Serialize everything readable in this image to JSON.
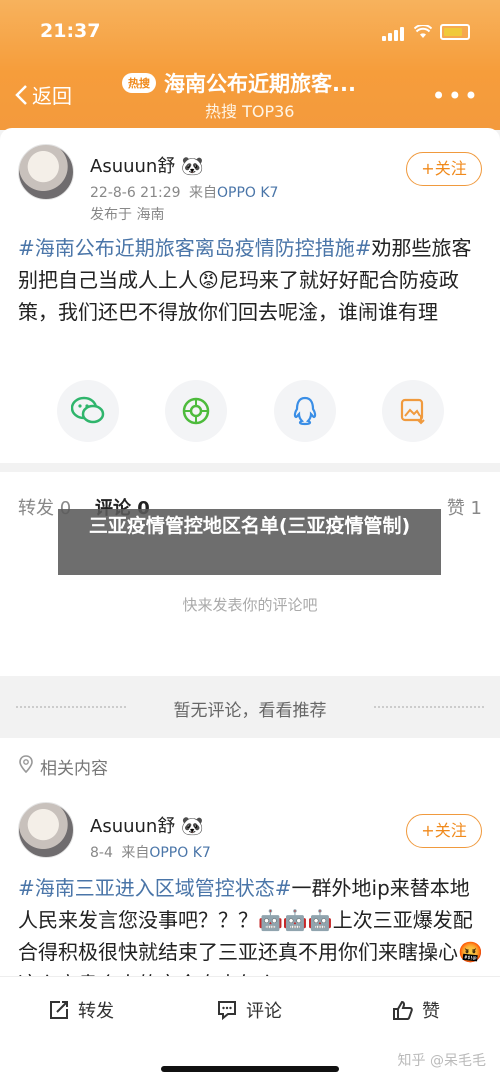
{
  "status_bar": {
    "time": "21:37"
  },
  "nav": {
    "back_label": "返回",
    "hot_badge": "热搜",
    "title": "海南公布近期旅客...",
    "subtitle": "热搜 TOP36",
    "more_glyph": "•••"
  },
  "post": {
    "author": "Asuuun舒",
    "author_emoji": "🐼",
    "date": "22-8-6 21:29",
    "from_prefix": "来自",
    "device": "OPPO K7",
    "location": "发布于 海南",
    "follow_label": "+关注",
    "hashtag": "#海南公布近期旅客离岛疫情防控措施#",
    "body": "劝那些旅客别把自己当成人上人😡尼玛来了就好好配合防疫政策，我们还巴不得放你们回去呢淦，谁闹谁有理"
  },
  "share_icons": [
    "wechat-icon",
    "moments-icon",
    "qq-icon",
    "save-image-icon"
  ],
  "tabs": {
    "repost": "转发 0",
    "comment": "评论 0",
    "like": "赞 1"
  },
  "overlay_text": "三亚疫情管控地区名单(三亚疫情管制)",
  "comment_placeholder": "快来发表你的评论吧",
  "recommend_text": "暂无评论，看看推荐",
  "related_title": "相关内容",
  "related_post": {
    "author": "Asuuun舒",
    "author_emoji": "🐼",
    "date": "8-4",
    "from_prefix": "来自",
    "device": "OPPO K7",
    "follow_label": "+关注",
    "hashtag": "#海南三亚进入区域管控状态#",
    "body": "一群外地ip来替本地人民来发言您没事吧？？？🤖🤖🤖上次三亚爆发配合得积极很快就结束了三亚还真不用你们来瞎操心🤬这么高贵个人的完全自由怎么"
  },
  "bottom_bar": {
    "repost": "转发",
    "comment": "评论",
    "like": "赞"
  },
  "watermark": "知乎 @呆毛毛",
  "colors": {
    "accent": "#f39a3d",
    "link": "#4a75a8"
  }
}
